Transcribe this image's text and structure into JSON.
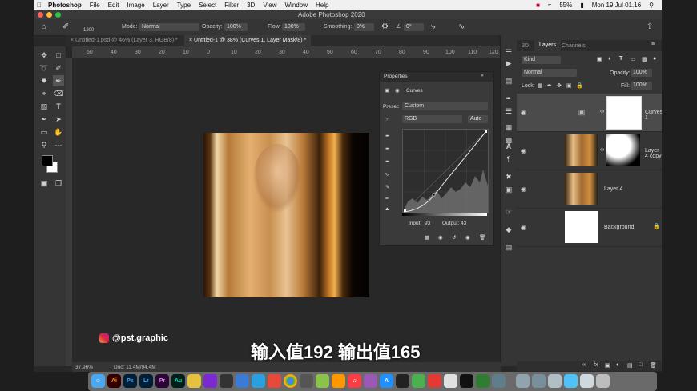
{
  "menubar": {
    "app_name": "Photoshop",
    "items": [
      "File",
      "Edit",
      "Image",
      "Layer",
      "Type",
      "Select",
      "Filter",
      "3D",
      "View",
      "Window",
      "Help"
    ],
    "battery": "55%",
    "datetime": "Mon 19 Jul 01.16"
  },
  "window": {
    "title": "Adobe Photoshop 2020"
  },
  "options": {
    "brush_size": "1200",
    "mode_label": "Mode:",
    "mode_value": "Normal",
    "opacity_label": "Opacity:",
    "opacity_value": "100%",
    "flow_label": "Flow:",
    "flow_value": "100%",
    "smoothing_label": "Smoothing:",
    "smoothing_value": "0%",
    "angle_value": "0°"
  },
  "tabs": [
    {
      "label": "Untitled-1.psd @ 46% (Layer 3, RGB/8) *"
    },
    {
      "label": "Untitled-1 @ 38% (Curves 1, Layer Mask/8) *"
    }
  ],
  "ruler": {
    "marks": [
      "50",
      "40",
      "30",
      "20",
      "10",
      "0",
      "10",
      "20",
      "30",
      "40",
      "50",
      "60",
      "70",
      "80",
      "90",
      "100",
      "110",
      "120"
    ]
  },
  "properties": {
    "title": "Properties",
    "section": "Curves",
    "preset_label": "Preset:",
    "preset_value": "Custom",
    "channel_value": "RGB",
    "auto_label": "Auto",
    "input_label": "Input:",
    "input_value": "93",
    "output_label": "Output:",
    "output_value": "43"
  },
  "layers_panel": {
    "tabs": [
      "3D",
      "Layers",
      "Channels"
    ],
    "filter_value": "Kind",
    "blend_value": "Normal",
    "opacity_label": "Opacity:",
    "opacity_value": "100%",
    "lock_label": "Lock:",
    "fill_label": "Fill:",
    "fill_value": "100%",
    "layers": [
      {
        "name": "Curves 1"
      },
      {
        "name": "Layer 4 copy"
      },
      {
        "name": "Layer 4"
      },
      {
        "name": "Background"
      }
    ]
  },
  "status": {
    "zoom": "37,96%",
    "doc": "Doc: 11,4M/94,4M"
  },
  "overlay": {
    "handle": "@pst.graphic",
    "subtitle": "输入值192 输出值165"
  },
  "dock": {
    "apps": [
      "Ai",
      "Ps",
      "Lr",
      "Pr",
      "Au"
    ]
  },
  "colors": {
    "accent": "#1473e6",
    "ps_blue": "#31a8ff",
    "ai_orange": "#ff9a00"
  }
}
